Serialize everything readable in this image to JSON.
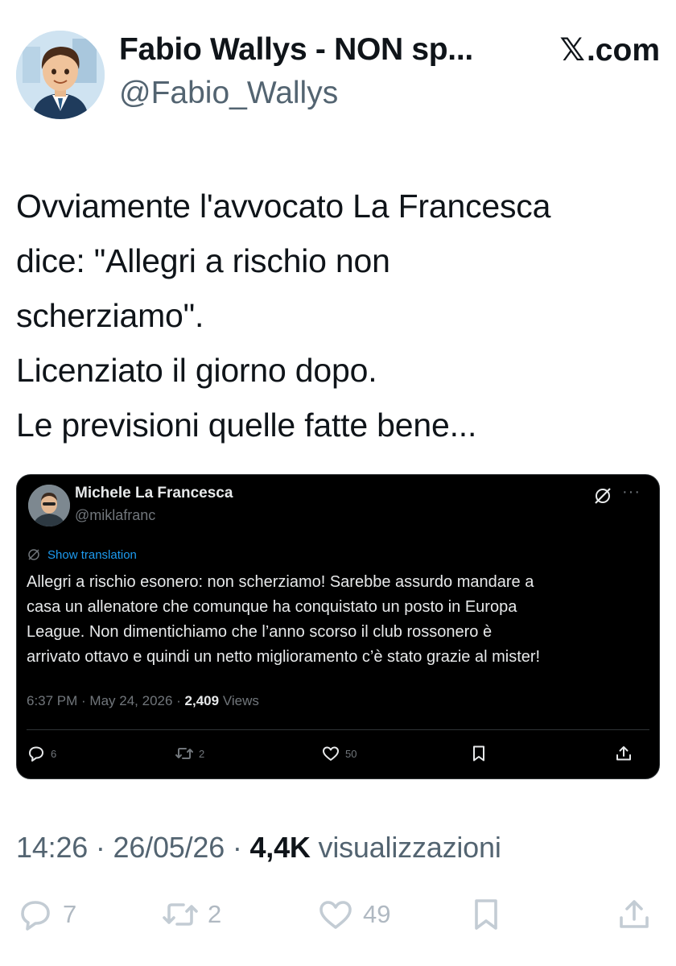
{
  "header": {
    "name": "Fabio Wallys - NON sp...",
    "handle": "@Fabio_Wallys",
    "site": ".com",
    "site_glyph": "𝕏"
  },
  "tweet": {
    "lines": [
      "Ovviamente l'avvocato La Francesca",
      "dice: \"Allegri a rischio non",
      "scherziamo\".",
      "Licenziato il giorno dopo.",
      "Le previsioni quelle fatte bene..."
    ]
  },
  "quote": {
    "name": "Michele La Francesca",
    "handle": "@miklafranc",
    "more": "···",
    "translate_label": "Show translation",
    "lines": [
      "Allegri a rischio esonero: non scherziamo! Sarebbe assurdo mandare a",
      "casa un allenatore che comunque ha conquistato un posto in Europa",
      "League. Non dimentichiamo che l’anno scorso il club rossonero è",
      "arrivato ottavo e quindi un netto miglioramento c’è stato grazie al mister!"
    ],
    "time": "6:37 PM",
    "date": "May 24, 2026",
    "views_count": "2,409",
    "views_label": "Views",
    "replies": "6",
    "reposts": "2",
    "likes": "50"
  },
  "meta": {
    "time": "14:26",
    "date": "26/05/26",
    "views_count": "4,4K",
    "views_label": "visualizzazioni"
  },
  "actions": {
    "replies": "7",
    "reposts": "2",
    "likes": "49"
  }
}
